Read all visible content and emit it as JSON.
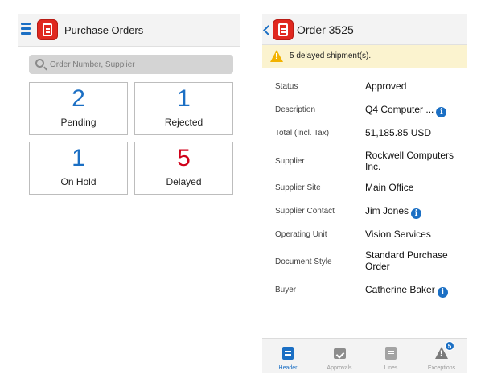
{
  "left_screen": {
    "header": {
      "title": "Purchase Orders"
    },
    "search": {
      "placeholder": "Order Number, Supplier"
    },
    "tiles": [
      {
        "count": "2",
        "label": "Pending"
      },
      {
        "count": "1",
        "label": "Rejected"
      },
      {
        "count": "1",
        "label": "On Hold"
      },
      {
        "count": "5",
        "label": "Delayed"
      }
    ]
  },
  "right_screen": {
    "header": {
      "title": "Order 3525"
    },
    "alert": {
      "text": "5 delayed shipment(s)."
    },
    "details": [
      {
        "label": "Status",
        "value": "Approved"
      },
      {
        "label": "Description",
        "value": "Q4 Computer ..."
      },
      {
        "label": "Total (Incl. Tax)",
        "value": "51,185.85 USD"
      },
      {
        "label": "Supplier",
        "value": "Rockwell Computers Inc."
      },
      {
        "label": "Supplier Site",
        "value": "Main Office"
      },
      {
        "label": "Supplier Contact",
        "value": "Jim Jones"
      },
      {
        "label": "Operating Unit",
        "value": "Vision Services"
      },
      {
        "label": "Document Style",
        "value": "Standard Purchase Order"
      },
      {
        "label": "Buyer",
        "value": "Catherine Baker"
      }
    ],
    "info_icon_glyph": "i",
    "tabs": [
      {
        "label": "Header",
        "active": true
      },
      {
        "label": "Approvals"
      },
      {
        "label": "Lines"
      },
      {
        "label": "Exceptions",
        "badge": "5"
      }
    ]
  },
  "colors": {
    "accent": "#1b6fc4",
    "delayed": "#d0021b",
    "app_icon": "#e0281f",
    "alert_bg": "#fbf3cf",
    "warning": "#f2b200"
  }
}
